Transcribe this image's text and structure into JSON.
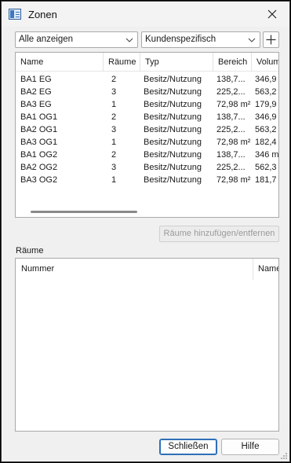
{
  "window": {
    "title": "Zonen"
  },
  "filters": {
    "show_all": "Alle anzeigen",
    "custom": "Kundenspezifisch"
  },
  "zones": {
    "columns": [
      "Name",
      "Räume",
      "Typ",
      "Bereich",
      "Volum"
    ],
    "rows": [
      [
        "BA1 EG",
        "2",
        "Besitz/Nutzung",
        "138,7...",
        "346,9"
      ],
      [
        "BA2 EG",
        "3",
        "Besitz/Nutzung",
        "225,2...",
        "563,2"
      ],
      [
        "BA3 EG",
        "1",
        "Besitz/Nutzung",
        "72,98 m²",
        "179,9"
      ],
      [
        "BA1 OG1",
        "2",
        "Besitz/Nutzung",
        "138,7...",
        "346,9"
      ],
      [
        "BA2 OG1",
        "3",
        "Besitz/Nutzung",
        "225,2...",
        "563,2"
      ],
      [
        "BA3 OG1",
        "1",
        "Besitz/Nutzung",
        "72,98 m²",
        "182,4"
      ],
      [
        "BA1 OG2",
        "2",
        "Besitz/Nutzung",
        "138,7...",
        "346 m"
      ],
      [
        "BA2 OG2",
        "3",
        "Besitz/Nutzung",
        "225,2...",
        "562,3"
      ],
      [
        "BA3 OG2",
        "1",
        "Besitz/Nutzung",
        "72,98 m²",
        "181,7"
      ]
    ]
  },
  "add_rooms_button": "Räume hinzufügen/entfernen",
  "rooms": {
    "label": "Räume",
    "columns": [
      "Nummer",
      "Name"
    ]
  },
  "buttons": {
    "close": "Schließen",
    "help": "Hilfe"
  },
  "icons": {
    "app": "zones-window-icon",
    "close": "close-icon",
    "dropdown": "chevron-down-icon",
    "add": "plus-icon"
  }
}
